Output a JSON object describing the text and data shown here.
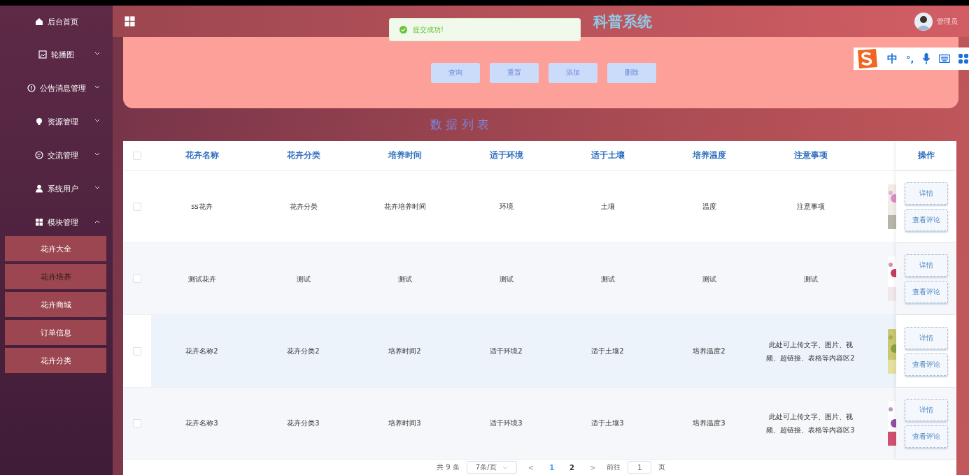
{
  "sidebar": {
    "items": [
      {
        "label": "后台首页"
      },
      {
        "label": "轮播图",
        "expanded": false
      },
      {
        "label": "公告消息管理",
        "expanded": false
      },
      {
        "label": "资源管理",
        "expanded": false
      },
      {
        "label": "交流管理",
        "expanded": false
      },
      {
        "label": "系统用户",
        "expanded": false
      },
      {
        "label": "模块管理",
        "expanded": true,
        "children": [
          {
            "label": "花卉大全",
            "selected": false
          },
          {
            "label": "花卉培养",
            "selected": true
          },
          {
            "label": "花卉商城",
            "selected": false
          },
          {
            "label": "订单信息",
            "selected": false
          },
          {
            "label": "花卉分类",
            "selected": false
          }
        ]
      }
    ]
  },
  "header": {
    "title": "科普系统",
    "user": "管理员"
  },
  "toast": {
    "message": "提交成功!"
  },
  "ime_bar": {
    "mode": "中",
    "punctuation": "°,"
  },
  "search_buttons": [
    "查询",
    "重置",
    "添加",
    "删除"
  ],
  "list_title": "数 据 列 表",
  "table": {
    "columns": [
      "花卉名称",
      "花卉分类",
      "培养时间",
      "适于环境",
      "适于土壤",
      "培养温度",
      "注意事项"
    ],
    "action_column": "操作",
    "all_checked": false,
    "rows": [
      {
        "checked": false,
        "highlighted": false,
        "cells": [
          "ss花卉",
          "花卉分类",
          "花卉培养时间",
          "环境",
          "土壤",
          "温度",
          "注意事项"
        ],
        "actions": [
          "详情",
          "查看评论"
        ]
      },
      {
        "checked": false,
        "highlighted": false,
        "cells": [
          "测试花卉",
          "测试",
          "测试",
          "测试",
          "测试",
          "测试",
          "测试"
        ],
        "actions": [
          "详情",
          "查看评论"
        ]
      },
      {
        "checked": false,
        "highlighted": true,
        "cells": [
          "花卉名称2",
          "花卉分类2",
          "培养时间2",
          "适于环境2",
          "适于土壤2",
          "培养温度2",
          "此处可上传文字、图片、视频、超链接、表格等内容区2"
        ],
        "actions": [
          "详情",
          "查看评论"
        ]
      },
      {
        "checked": false,
        "highlighted": false,
        "cells": [
          "花卉名称3",
          "花卉分类3",
          "培养时间3",
          "适于环境3",
          "适于土壤3",
          "培养温度3",
          "此处可上传文字、图片、视频、超链接、表格等内容区3"
        ],
        "actions": [
          "详情",
          "查看评论"
        ]
      }
    ]
  },
  "pagination": {
    "total": "共 9 条",
    "page_size": "7条/页",
    "prev": "<",
    "pages": [
      {
        "label": "1",
        "selected": true
      },
      {
        "label": "2",
        "selected": false
      }
    ],
    "next": ">",
    "goto_label": "前往",
    "goto_value": "1",
    "goto_suffix": "页"
  }
}
